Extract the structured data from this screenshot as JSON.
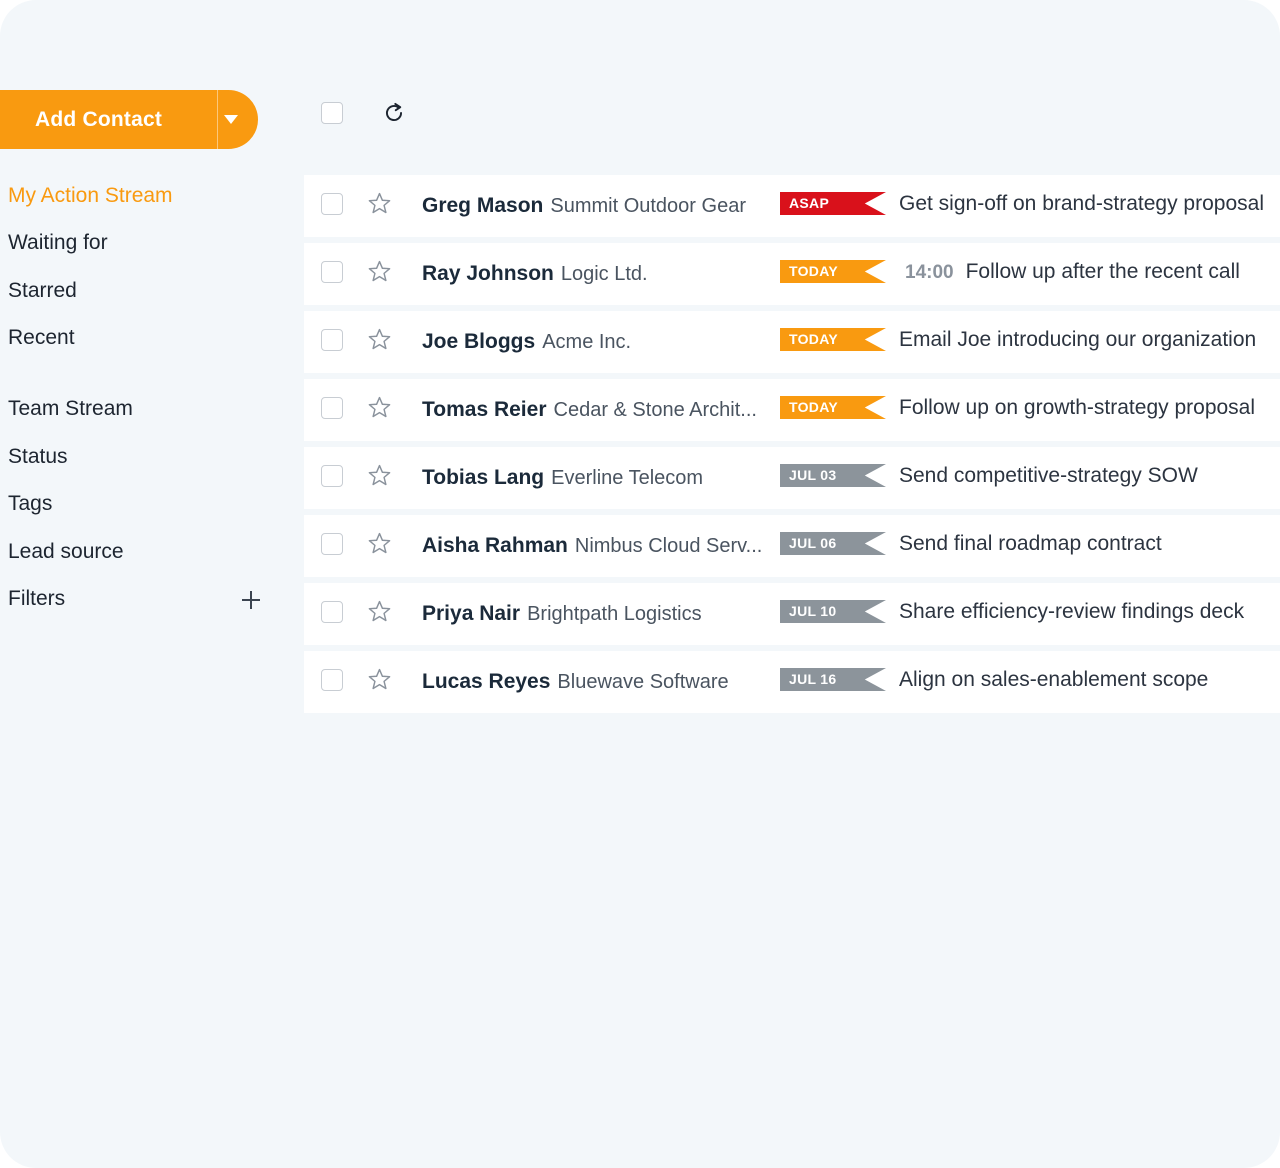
{
  "sidebar": {
    "add_contact_label": "Add Contact",
    "nav": [
      {
        "label": "My Action Stream",
        "active": true
      },
      {
        "label": "Waiting for"
      },
      {
        "label": "Starred"
      },
      {
        "label": "Recent"
      },
      {
        "label": "Team Stream"
      },
      {
        "label": "Status"
      },
      {
        "label": "Tags"
      },
      {
        "label": "Lead source"
      },
      {
        "label": "Filters"
      }
    ]
  },
  "colors": {
    "accent": "#f99a10",
    "asap": "#d9111b",
    "today": "#f99a10",
    "date": "#8c949b"
  },
  "icons": {
    "add_contact_dropdown": "chevron-down-icon",
    "toolbar_refresh": "refresh-icon",
    "row_star": "star-icon",
    "filters_add": "plus-icon"
  },
  "rows": [
    {
      "name": "Greg Mason",
      "company": "Summit Outdoor Gear",
      "badge": "ASAP",
      "badge_type": "asap",
      "time": "",
      "task": "Get sign-off on brand-strategy proposal"
    },
    {
      "name": "Ray Johnson",
      "company": "Logic Ltd.",
      "badge": "TODAY",
      "badge_type": "today",
      "time": "14:00",
      "task": "Follow up after the recent call"
    },
    {
      "name": "Joe Bloggs",
      "company": "Acme Inc.",
      "badge": "TODAY",
      "badge_type": "today",
      "time": "",
      "task": "Email Joe introducing our organization"
    },
    {
      "name": "Tomas Reier",
      "company": "Cedar & Stone Archit...",
      "badge": "TODAY",
      "badge_type": "today",
      "time": "",
      "task": "Follow up on growth-strategy proposal"
    },
    {
      "name": "Tobias Lang",
      "company": "Everline Telecom",
      "badge": "JUL 03",
      "badge_type": "date",
      "time": "",
      "task": "Send competitive-strategy SOW"
    },
    {
      "name": "Aisha Rahman",
      "company": "Nimbus Cloud Serv...",
      "badge": "JUL 06",
      "badge_type": "date",
      "time": "",
      "task": "Send final roadmap contract"
    },
    {
      "name": "Priya Nair",
      "company": "Brightpath Logistics",
      "badge": "JUL 10",
      "badge_type": "date",
      "time": "",
      "task": "Share efficiency-review findings deck"
    },
    {
      "name": "Lucas Reyes",
      "company": "Bluewave Software",
      "badge": "JUL 16",
      "badge_type": "date",
      "time": "",
      "task": "Align on sales-enablement scope"
    }
  ]
}
